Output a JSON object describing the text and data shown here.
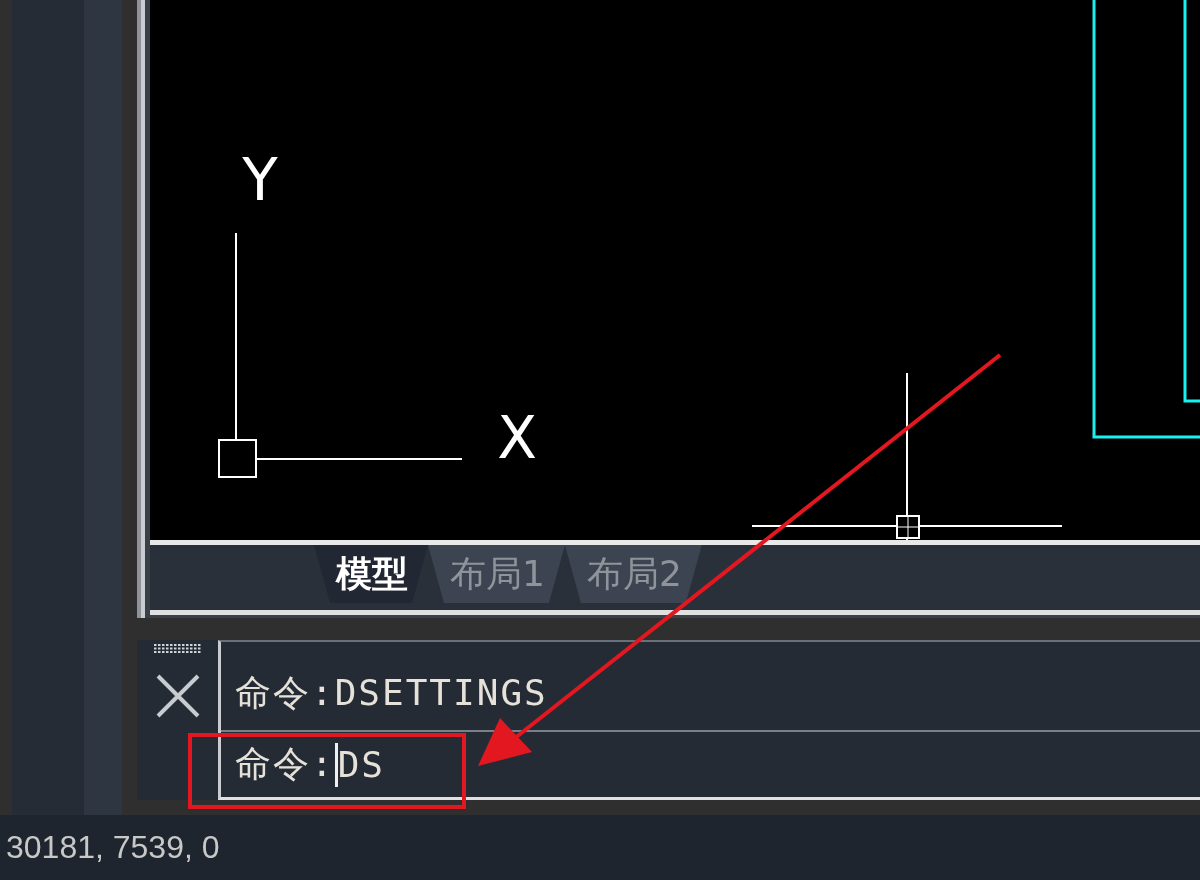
{
  "canvas": {
    "ucs": {
      "x_label": "X",
      "y_label": "Y"
    }
  },
  "layout_tabs": [
    {
      "label": "模型",
      "selected": true
    },
    {
      "label": "布局1",
      "selected": false
    },
    {
      "label": "布局2",
      "selected": false
    }
  ],
  "command_line": {
    "history": [
      "命令:DSETTINGS"
    ],
    "prompt": "命令:",
    "value": "DS"
  },
  "status_bar": {
    "coordinates": "30181, 7539, 0"
  }
}
